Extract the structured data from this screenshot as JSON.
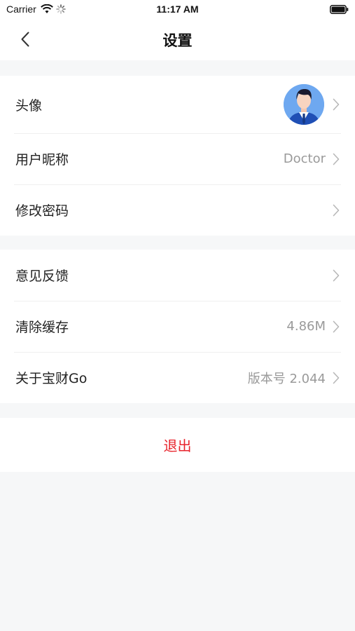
{
  "status_bar": {
    "carrier": "Carrier",
    "time": "11:17 AM",
    "icons": [
      "wifi-icon",
      "activity-spinner-icon",
      "battery-icon"
    ]
  },
  "nav": {
    "title": "设置",
    "back_icon": "chevron-left-icon"
  },
  "groups": [
    {
      "rows": [
        {
          "label": "头像",
          "value": "",
          "icon": "avatar-image"
        },
        {
          "label": "用户昵称",
          "value": "Doctor"
        },
        {
          "label": "修改密码",
          "value": ""
        }
      ]
    },
    {
      "rows": [
        {
          "label": "意见反馈",
          "value": ""
        },
        {
          "label": "清除缓存",
          "value": "4.86M"
        },
        {
          "label": "关于宝财Go",
          "value": "版本号 2.044"
        }
      ]
    }
  ],
  "logout": {
    "label": "退出"
  },
  "colors": {
    "accent_red": "#e8242c",
    "background": "#f6f7f8",
    "secondary_text": "#9a9a9a",
    "avatar_bg": "#6ea8f0"
  }
}
